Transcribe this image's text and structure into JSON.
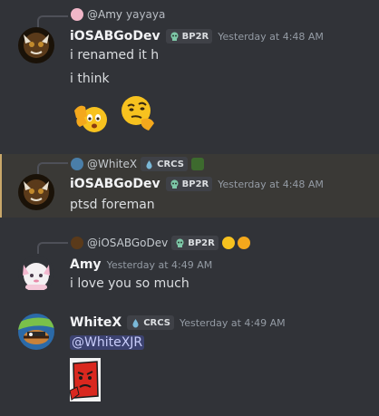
{
  "messages": [
    {
      "reply": {
        "name": "@Amy",
        "text": "yayaya"
      },
      "author": "iOSABGoDev",
      "tag": "BP2R",
      "time": "Yesterday at 4:48 AM",
      "lines": [
        "i renamed it h",
        "i think"
      ],
      "emojis": [
        "clapping-hands-emoji",
        "thinking-face-emoji"
      ]
    },
    {
      "reply": {
        "name": "@WhiteX",
        "tag": "CRCS"
      },
      "author": "iOSABGoDev",
      "tag": "BP2R",
      "time": "Yesterday at 4:48 AM",
      "lines": [
        "ptsd foreman"
      ]
    },
    {
      "reply": {
        "name": "@iOSABGoDev",
        "tag": "BP2R"
      },
      "author": "Amy",
      "time": "Yesterday at 4:49 AM",
      "lines": [
        "i love you so much"
      ]
    },
    {
      "author": "WhiteX",
      "tag": "CRCS",
      "time": "Yesterday at 4:49 AM",
      "mention": "@WhiteXJR",
      "attachment": "red-block-character-image"
    }
  ],
  "colors": {
    "background": "#313338",
    "highlight": "#3a3936",
    "highlight_border": "#c9a86a",
    "mention_bg": "#3c4270",
    "mention_text": "#c9cdfb",
    "timestamp": "#949ba4"
  }
}
